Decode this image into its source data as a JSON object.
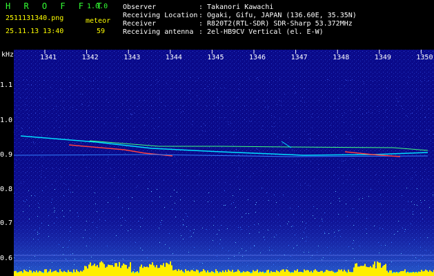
{
  "header": {
    "app_title": "H R O F F T",
    "version": "1.0.0",
    "filename": "2511131340.png",
    "datetime": "25.11.13 13:40",
    "meteor_label": "meteor",
    "meteor_count": "59",
    "fields": [
      {
        "label": "Observer",
        "value": ": Takanori Kawachi"
      },
      {
        "label": "Receiving Location",
        "value": ": Ogaki, Gifu, JAPAN (136.60E, 35.35N)"
      },
      {
        "label": "Receiver",
        "value": ": R820T2(RTL-SDR) SDR-Sharp 53.372MHz"
      },
      {
        "label": "Receiving antenna",
        "value": ": 2el-HB9CV Vertical (el. E-W)"
      }
    ]
  },
  "axis": {
    "y_unit": "kHz",
    "y_ticks": [
      "1.1",
      "1.0",
      "0.9",
      "0.8",
      "0.7",
      "0.6"
    ],
    "x_ticks": [
      "1341",
      "1342",
      "1343",
      "1344",
      "1345",
      "1346",
      "1347",
      "1348",
      "1349",
      "1350"
    ]
  },
  "colors": {
    "background": "#000000",
    "plot_bg": "#0a0a8a",
    "label_green": "#33ff33",
    "label_yellow": "#ffff00",
    "trace_cyan": "#00e0ff",
    "trace_red": "#ff4040",
    "noise_bar_yellow": "#ffee00"
  }
}
